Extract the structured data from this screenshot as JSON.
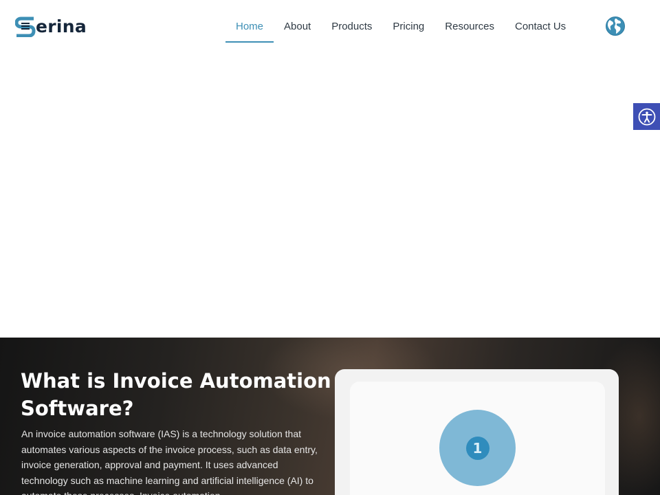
{
  "brand": {
    "name": "erina",
    "logo_icon": "serina-s-logo-icon",
    "colors": {
      "primary": "#3d8fb5",
      "dark": "#15263a",
      "accessibility": "#3e4fb5"
    }
  },
  "nav": {
    "items": [
      {
        "label": "Home",
        "active": true
      },
      {
        "label": "About",
        "active": false
      },
      {
        "label": "Products",
        "active": false
      },
      {
        "label": "Pricing",
        "active": false
      },
      {
        "label": "Resources",
        "active": false
      },
      {
        "label": "Contact Us",
        "active": false
      }
    ],
    "language_icon": "globe-icon"
  },
  "accessibility": {
    "icon": "accessibility-person-icon"
  },
  "hero": {
    "title": "What is Invoice Automation Software?",
    "body": "An invoice automation software (IAS) is a technology solution that automates various aspects of the invoice process, such as data entry, invoice generation, approval and payment. It uses advanced technology such as machine learning and artificial intelligence (AI) to automate these processes. Invoice automation"
  },
  "card": {
    "step_number": "1"
  }
}
